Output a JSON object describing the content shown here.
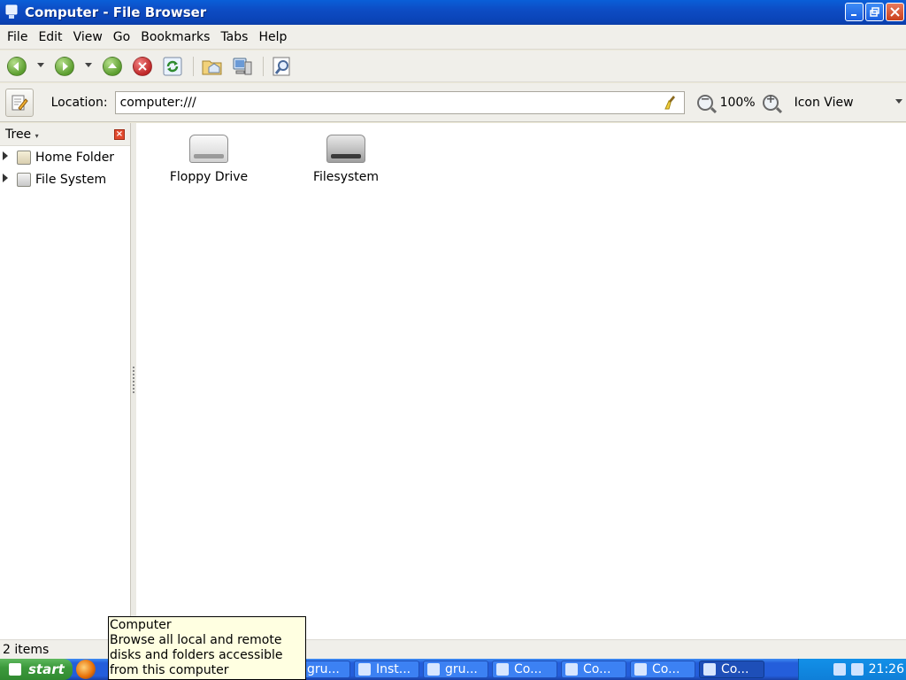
{
  "window": {
    "title": "Computer - File Browser"
  },
  "menu": {
    "items": [
      "File",
      "Edit",
      "View",
      "Go",
      "Bookmarks",
      "Tabs",
      "Help"
    ]
  },
  "toolbar": {
    "buttons": [
      "back-icon",
      "forward-icon",
      "up-icon",
      "stop-icon",
      "reload-icon",
      "home-icon",
      "computer-icon",
      "search-icon"
    ]
  },
  "location": {
    "label": "Location:",
    "value": "computer:///",
    "zoom": "100%",
    "view_mode": "Icon View"
  },
  "sidebar": {
    "header": "Tree",
    "items": [
      {
        "label": "Home Folder"
      },
      {
        "label": "File System"
      }
    ]
  },
  "main": {
    "items": [
      {
        "label": "Floppy Drive",
        "icon": "floppy-drive-icon"
      },
      {
        "label": "Filesystem",
        "icon": "harddisk-icon"
      }
    ]
  },
  "status": {
    "text": "2 items"
  },
  "tooltip": {
    "title": "Computer",
    "body": "Browse all local and remote disks and folders accessible from this computer"
  },
  "taskbar": {
    "start_label": "start",
    "tasks": [
      "gru...",
      "Inst...",
      "gru...",
      "Co...",
      "Co...",
      "Co...",
      "Co..."
    ],
    "clock": "21:26"
  },
  "colors": {
    "titlebar": "#0a4ac0",
    "taskbar": "#245edb",
    "start": "#3c9a3c"
  }
}
